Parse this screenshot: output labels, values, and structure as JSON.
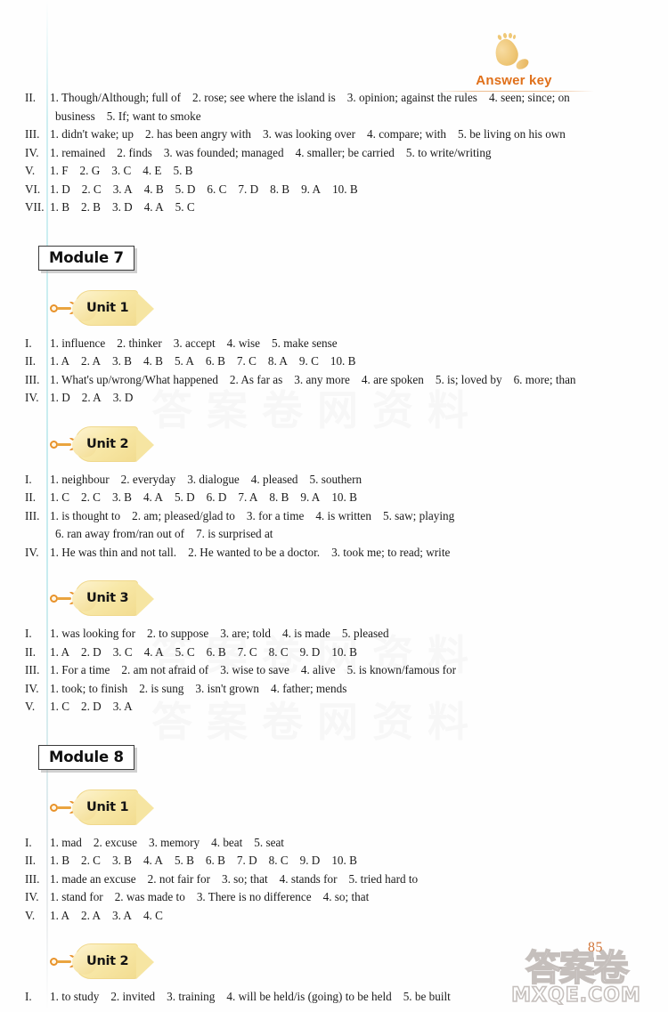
{
  "header": {
    "answer_key_label": "Answer key",
    "footprint_icon": "footprint-icon"
  },
  "page": {
    "number": "85",
    "watermark_cn": "答案卷",
    "watermark_domain": "MXQE.COM",
    "background_watermark": "答案卷网资料"
  },
  "top_section": {
    "lines": [
      {
        "numeral": "II.",
        "items": [
          "1. Though/Although; full of",
          "2. rose; see where the island is",
          "3. opinion; against the rules",
          "4. seen; since; on"
        ],
        "continuation": [
          "business",
          "5. If; want to smoke"
        ]
      },
      {
        "numeral": "III.",
        "items": [
          "1. didn't wake; up",
          "2. has been angry with",
          "3. was looking over",
          "4. compare; with",
          "5. be living on his own"
        ]
      },
      {
        "numeral": "IV.",
        "items": [
          "1. remained",
          "2. finds",
          "3. was founded; managed",
          "4. smaller; be carried",
          "5. to write/writing"
        ]
      },
      {
        "numeral": "V.",
        "items": [
          "1. F",
          "2. G",
          "3. C",
          "4. E",
          "5. B"
        ]
      },
      {
        "numeral": "VI.",
        "items": [
          "1. D",
          "2. C",
          "3. A",
          "4. B",
          "5. D",
          "6. C",
          "7. D",
          "8. B",
          "9. A",
          "10. B"
        ]
      },
      {
        "numeral": "VII.",
        "items": [
          "1. B",
          "2. B",
          "3. D",
          "4. A",
          "5. C"
        ]
      }
    ]
  },
  "modules": [
    {
      "title": "Module 7",
      "units": [
        {
          "label": "Unit 1",
          "lines": [
            {
              "numeral": "I.",
              "items": [
                "1. influence",
                "2. thinker",
                "3. accept",
                "4. wise",
                "5. make sense"
              ]
            },
            {
              "numeral": "II.",
              "items": [
                "1. A",
                "2. A",
                "3. B",
                "4. B",
                "5. A",
                "6. B",
                "7. C",
                "8. A",
                "9. C",
                "10. B"
              ]
            },
            {
              "numeral": "III.",
              "items": [
                "1. What's up/wrong/What happened",
                "2. As far as",
                "3. any more",
                "4. are spoken",
                "5. is; loved by",
                "6. more; than"
              ]
            },
            {
              "numeral": "IV.",
              "items": [
                "1. D",
                "2. A",
                "3. D"
              ]
            }
          ]
        },
        {
          "label": "Unit 2",
          "lines": [
            {
              "numeral": "I.",
              "items": [
                "1. neighbour",
                "2. everyday",
                "3. dialogue",
                "4. pleased",
                "5. southern"
              ]
            },
            {
              "numeral": "II.",
              "items": [
                "1. C",
                "2. C",
                "3. B",
                "4. A",
                "5. D",
                "6. D",
                "7. A",
                "8. B",
                "9. A",
                "10. B"
              ]
            },
            {
              "numeral": "III.",
              "items": [
                "1. is thought to",
                "2. am; pleased/glad to",
                "3. for a time",
                "4. is written",
                "5. saw; playing"
              ],
              "continuation": [
                "6. ran away from/ran out of",
                "7. is surprised at"
              ]
            },
            {
              "numeral": "IV.",
              "items": [
                "1. He was thin and not tall.",
                "2. He wanted to be a doctor.",
                "3. took me; to read; write"
              ]
            }
          ]
        },
        {
          "label": "Unit 3",
          "lines": [
            {
              "numeral": "I.",
              "items": [
                "1. was looking for",
                "2. to suppose",
                "3. are; told",
                "4. is made",
                "5. pleased"
              ]
            },
            {
              "numeral": "II.",
              "items": [
                "1. A",
                "2. D",
                "3. C",
                "4. A",
                "5. C",
                "6. B",
                "7. C",
                "8. C",
                "9. D",
                "10. B"
              ]
            },
            {
              "numeral": "III.",
              "items": [
                "1. For a time",
                "2. am not afraid of",
                "3. wise to save",
                "4. alive",
                "5. is known/famous for"
              ]
            },
            {
              "numeral": "IV.",
              "items": [
                "1. took; to finish",
                "2. is sung",
                "3. isn't grown",
                "4. father; mends"
              ]
            },
            {
              "numeral": "V.",
              "items": [
                "1. C",
                "2. D",
                "3. A"
              ]
            }
          ]
        }
      ]
    },
    {
      "title": "Module 8",
      "units": [
        {
          "label": "Unit 1",
          "lines": [
            {
              "numeral": "I.",
              "items": [
                "1. mad",
                "2. excuse",
                "3. memory",
                "4. beat",
                "5. seat"
              ]
            },
            {
              "numeral": "II.",
              "items": [
                "1. B",
                "2. C",
                "3. B",
                "4. A",
                "5. B",
                "6. B",
                "7. D",
                "8. C",
                "9. D",
                "10. B"
              ]
            },
            {
              "numeral": "III.",
              "items": [
                "1. made an excuse",
                "2. not fair for",
                "3. so; that",
                "4. stands for",
                "5. tried hard to"
              ]
            },
            {
              "numeral": "IV.",
              "items": [
                "1. stand for",
                "2. was made to",
                "3. There is no difference",
                "4. so; that"
              ]
            },
            {
              "numeral": "V.",
              "items": [
                "1. A",
                "2. A",
                "3. A",
                "4. C"
              ]
            }
          ]
        },
        {
          "label": "Unit 2",
          "lines": [
            {
              "numeral": "I.",
              "items": [
                "1. to study",
                "2. invited",
                "3. training",
                "4. will be held/is (going) to be held",
                "5. be built"
              ]
            }
          ]
        }
      ]
    }
  ]
}
